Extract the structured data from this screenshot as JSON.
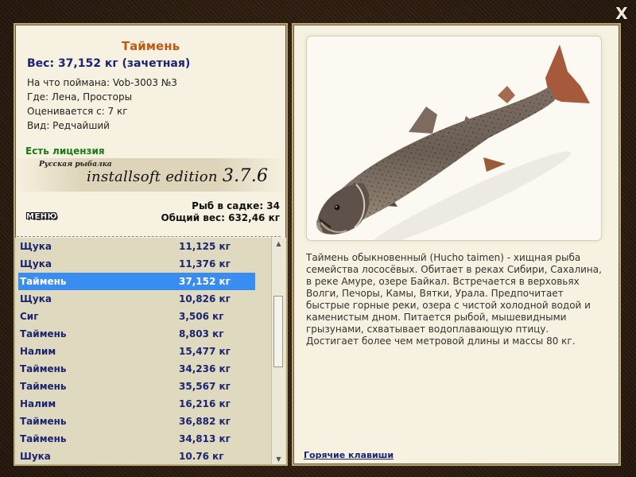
{
  "window": {
    "close_label": "X"
  },
  "fish": {
    "title": "Таймень",
    "weight_line": "Вес: 37,152 кг (зачетная)",
    "caught_on": "На что поймана: Vob-3003 №3",
    "location": "Где: Лена, Просторы",
    "valued_from": "Оценивается с: 7 кг",
    "kind": "Вид: Редчайший",
    "description": "Таймень обыкновенный (Hucho taimen) - хищная рыба семейства лососёвых. Обитает в реках Сибири, Сахалина, в реке Амуре, озере Байкал. Встречается в верховьях Волги, Печоры, Камы, Вятки, Урала. Предпочитает быстрые горные реки, озера с чистой холодной водой и каменистым дном. Питается рыбой, мышевидными грызунами, схватывает водоплавающую птицу. Достигает более чем метровой длины и массы 80 кг."
  },
  "license": "Есть лицензия",
  "watermark": {
    "small": "Русская рыбалка",
    "big": "installsoft edition ",
    "version": "3.7.6"
  },
  "stats": {
    "fish_in_keepnet": "Рыб в садке: 34",
    "total_weight": "Общий вес: 632,46 кг"
  },
  "menu_label": "МЕНЮ",
  "catch_list": [
    {
      "name": "Щука",
      "weight": "11,125 кг"
    },
    {
      "name": "Щука",
      "weight": "11,376 кг"
    },
    {
      "name": "Таймень",
      "weight": "37,152 кг",
      "selected": true
    },
    {
      "name": "Щука",
      "weight": "10,826 кг"
    },
    {
      "name": "Сиг",
      "weight": "3,506 кг"
    },
    {
      "name": "Таймень",
      "weight": "8,803 кг"
    },
    {
      "name": "Налим",
      "weight": "15,477 кг"
    },
    {
      "name": "Таймень",
      "weight": "34,236 кг"
    },
    {
      "name": "Таймень",
      "weight": "35,567 кг"
    },
    {
      "name": "Налим",
      "weight": "16,216 кг"
    },
    {
      "name": "Таймень",
      "weight": "36,882 кг"
    },
    {
      "name": "Таймень",
      "weight": "34,813 кг"
    },
    {
      "name": "Шука",
      "weight": "10.76 кг"
    }
  ],
  "hotkeys_link": "Горячие клавиши",
  "colors": {
    "title": "#bf5a12",
    "weight": "#1a2470",
    "license": "#1a7a1a",
    "selected_row": "#3a8df0"
  },
  "icons": {
    "close": "close-icon",
    "scroll_up": "scroll-up-icon",
    "scroll_down": "scroll-down-icon"
  }
}
